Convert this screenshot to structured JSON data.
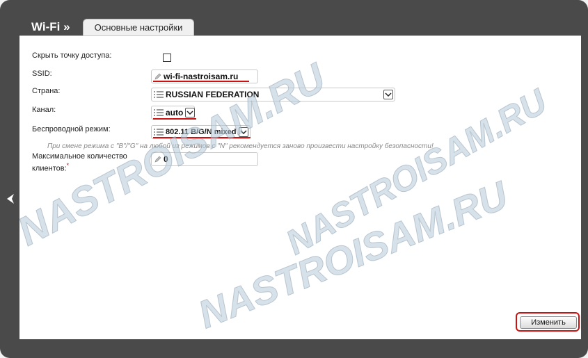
{
  "header": {
    "title": "Wi-Fi »"
  },
  "tabs": [
    {
      "label": "Основные настройки",
      "active": true
    }
  ],
  "form": {
    "hide_ap_label": "Скрыть точку доступа:",
    "hide_ap_checked": false,
    "ssid_label": "SSID:",
    "ssid_value": "wi-fi-nastroisam.ru",
    "country_label": "Страна:",
    "country_value": "RUSSIAN FEDERATION",
    "channel_label": "Канал:",
    "channel_value": "auto",
    "mode_label": "Беспроводной режим:",
    "mode_value": "802.11 B/G/N mixed",
    "mode_note": "При смене режима с \"B\"/\"G\" на любой из режимов с \"N\" рекомендуется заново произвести настройку безопасности!",
    "max_clients_label_line1": "Максимальное количество",
    "max_clients_label_line2": "клиентов:",
    "max_clients_required_mark": "*",
    "max_clients_value": "0"
  },
  "actions": {
    "apply_label": "Изменить"
  },
  "watermark": "NASTROISAM.RU",
  "icons": {
    "nav_back": "chevron-left-icon",
    "text_field": "pencil-icon",
    "select_field": "list-icon",
    "dropdown": "chevron-down-icon"
  },
  "colors": {
    "frame": "#4a4a4a",
    "panel": "#ffffff",
    "highlight": "#cc1111",
    "note_text": "#888888"
  }
}
